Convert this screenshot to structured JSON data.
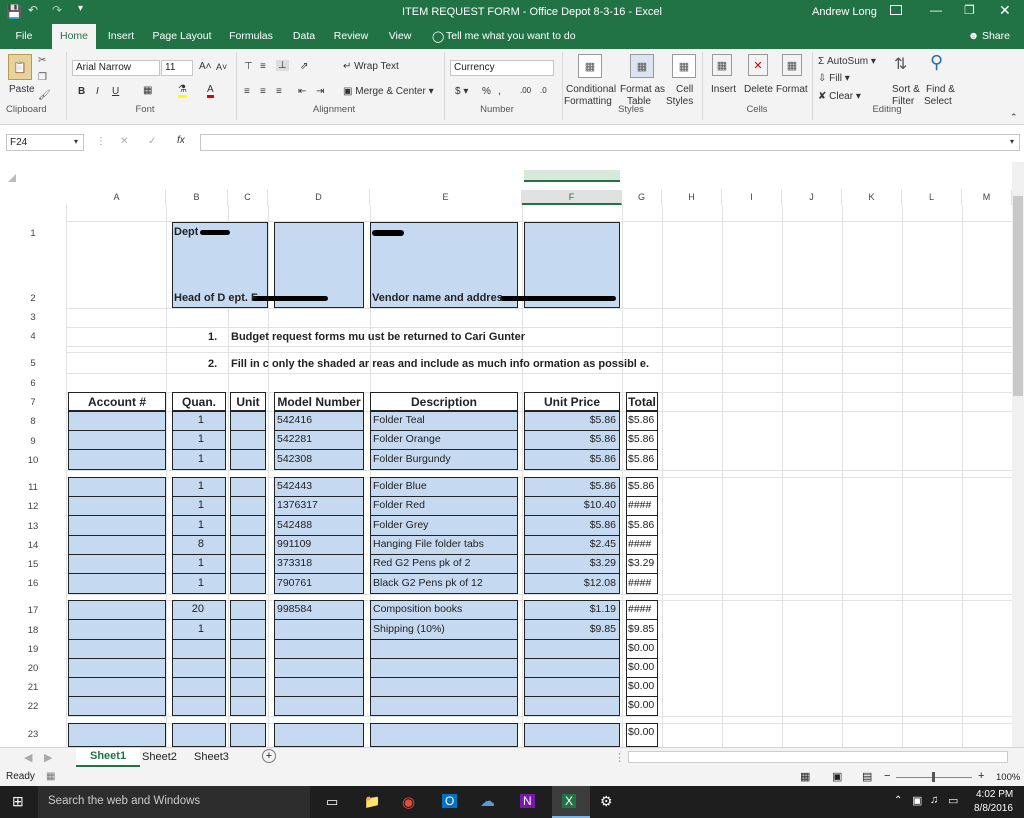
{
  "window": {
    "title": "ITEM REQUEST FORM - Office Depot 8-3-16 - Excel",
    "user": "Andrew Long"
  },
  "tabs": [
    "File",
    "Home",
    "Insert",
    "Page Layout",
    "Formulas",
    "Data",
    "Review",
    "View"
  ],
  "tell_me": "Tell me what you want to do",
  "share": "Share",
  "ribbon": {
    "paste": "Paste",
    "font_name": "Arial Narrow",
    "font_size": "11",
    "wrap_text": "Wrap Text",
    "merge_center": "Merge & Center",
    "number_format": "Currency",
    "conditional": "Conditional",
    "formatting": "Formatting",
    "format_as": "Format as",
    "table": "Table",
    "cell": "Cell",
    "styles": "Styles",
    "insert": "Insert",
    "delete": "Delete",
    "format": "Format",
    "autosum": "AutoSum",
    "fill": "Fill",
    "clear": "Clear",
    "sort_filter": "Sort &",
    "filter": "Filter",
    "find_select": "Find &",
    "select": "Select",
    "groups": {
      "clipboard": "Clipboard",
      "font": "Font",
      "alignment": "Alignment",
      "number": "Number",
      "styles": "Styles",
      "cells": "Cells",
      "editing": "Editing"
    }
  },
  "formula_bar": {
    "name_box": "F24",
    "fx": "fx",
    "value": ""
  },
  "columns": [
    "A",
    "B",
    "C",
    "D",
    "E",
    "F",
    "G",
    "H",
    "I",
    "J",
    "K",
    "L",
    "M"
  ],
  "rows": [
    "1",
    "2",
    "3",
    "4",
    "5",
    "6",
    "7",
    "8",
    "9",
    "10",
    "11",
    "12",
    "13",
    "14",
    "15",
    "16",
    "17",
    "18",
    "19",
    "20",
    "21",
    "22",
    "23"
  ],
  "header_cells": {
    "dept": "Dept",
    "head_of_dept": "Head of D  ept. F",
    "vendor": "Vendor name and address",
    "instr1_num": "1.",
    "instr1": "Budget   request forms mu  ust be returned to Cari Gunter",
    "instr2_num": "2.",
    "instr2": "Fill in c  only the shaded ar  reas and include as much info  ormation as possibl  e."
  },
  "table_headers": {
    "account": "Account #",
    "quan": "Quan.",
    "unit": "Unit",
    "model": "Model Number",
    "desc": "Description",
    "price": "Unit Price",
    "total": "Total"
  },
  "items": [
    {
      "row": "8",
      "quan": "1",
      "model": "542416",
      "desc": "Folder Teal",
      "price": "$5.86",
      "total": "$5.86"
    },
    {
      "row": "9",
      "quan": "1",
      "model": "542281",
      "desc": "Folder Orange",
      "price": "$5.86",
      "total": "$5.86"
    },
    {
      "row": "10",
      "quan": "1",
      "model": "542308",
      "desc": "Folder Burgundy",
      "price": "$5.86",
      "total": "$5.86"
    },
    {
      "row": "11",
      "quan": "1",
      "model": "542443",
      "desc": "Folder Blue",
      "price": "$5.86",
      "total": "$5.86"
    },
    {
      "row": "12",
      "quan": "1",
      "model": "1376317",
      "desc": "Folder Red",
      "price": "$10.40",
      "total": "####"
    },
    {
      "row": "13",
      "quan": "1",
      "model": "542488",
      "desc": "Folder Grey",
      "price": "$5.86",
      "total": "$5.86"
    },
    {
      "row": "14",
      "quan": "8",
      "model": "991109",
      "desc": "Hanging File folder tabs",
      "price": "$2.45",
      "total": "####"
    },
    {
      "row": "15",
      "quan": "1",
      "model": "373318",
      "desc": "Red G2 Pens pk of 2",
      "price": "$3.29",
      "total": "$3.29"
    },
    {
      "row": "16",
      "quan": "1",
      "model": "790761",
      "desc": "Black G2 Pens pk of 12",
      "price": "$12.08",
      "total": "####"
    },
    {
      "row": "17",
      "quan": "20",
      "model": "998584",
      "desc": "Composition books",
      "price": "$1.19",
      "total": "####"
    },
    {
      "row": "18",
      "quan": "1",
      "model": "",
      "desc": "Shipping (10%)",
      "price": "$9.85",
      "total": "$9.85"
    },
    {
      "row": "19",
      "quan": "",
      "model": "",
      "desc": "",
      "price": "",
      "total": "$0.00"
    },
    {
      "row": "20",
      "quan": "",
      "model": "",
      "desc": "",
      "price": "",
      "total": "$0.00"
    },
    {
      "row": "21",
      "quan": "",
      "model": "",
      "desc": "",
      "price": "",
      "total": "$0.00"
    },
    {
      "row": "22",
      "quan": "",
      "model": "",
      "desc": "",
      "price": "",
      "total": "$0.00"
    },
    {
      "row": "23",
      "quan": "",
      "model": "",
      "desc": "",
      "price": "",
      "total": "$0.00"
    }
  ],
  "sheets": [
    "Sheet1",
    "Sheet2",
    "Sheet3"
  ],
  "status": {
    "ready": "Ready",
    "zoom": "100%"
  },
  "taskbar": {
    "search": "Search the web and Windows",
    "time": "4:02 PM",
    "date": "8/8/2016"
  },
  "colors": {
    "excel_green": "#217346",
    "shade": "#c5d9f1",
    "taskbar": "#1e1e1e"
  }
}
